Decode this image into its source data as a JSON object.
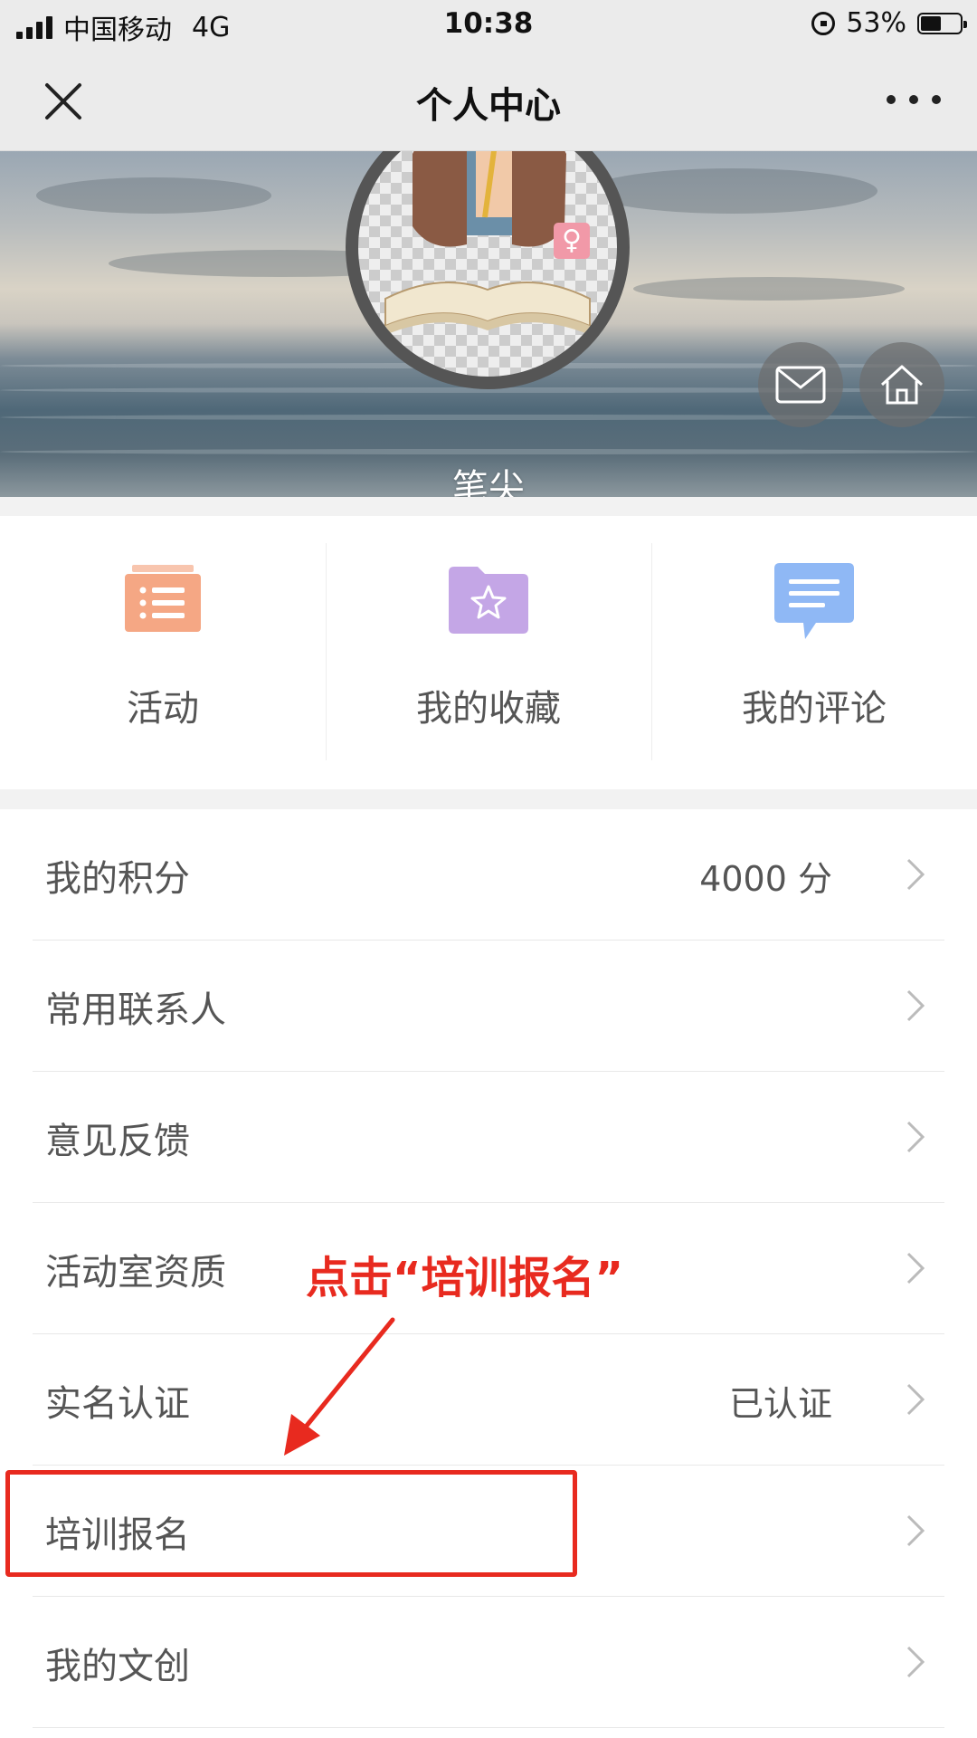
{
  "status_bar": {
    "carrier": "中国移动",
    "network": "4G",
    "time": "10:38",
    "battery": "53%",
    "battery_level": 0.53
  },
  "nav": {
    "title": "个人中心",
    "close_icon": "close-icon",
    "more_icon": "more-icon"
  },
  "profile": {
    "username": "笔尖",
    "gender_symbol": "♀",
    "message_icon": "envelope-icon",
    "home_icon": "home-icon"
  },
  "tiles": [
    {
      "label": "活动",
      "icon": "activity-list-icon",
      "color": "#f5a784"
    },
    {
      "label": "我的收藏",
      "icon": "favorite-folder-icon",
      "color": "#c4a6e6"
    },
    {
      "label": "我的评论",
      "icon": "comment-bubble-icon",
      "color": "#8fb8f5"
    }
  ],
  "menu": [
    {
      "label": "我的积分",
      "value": "4000 分"
    },
    {
      "label": "常用联系人",
      "value": ""
    },
    {
      "label": "意见反馈",
      "value": ""
    },
    {
      "label": "活动室资质",
      "value": ""
    },
    {
      "label": "实名认证",
      "value": "已认证"
    },
    {
      "label": "培训报名",
      "value": ""
    },
    {
      "label": "我的文创",
      "value": ""
    }
  ],
  "annotation": {
    "text": "点击“培训报名”",
    "color": "#e82a1f"
  }
}
